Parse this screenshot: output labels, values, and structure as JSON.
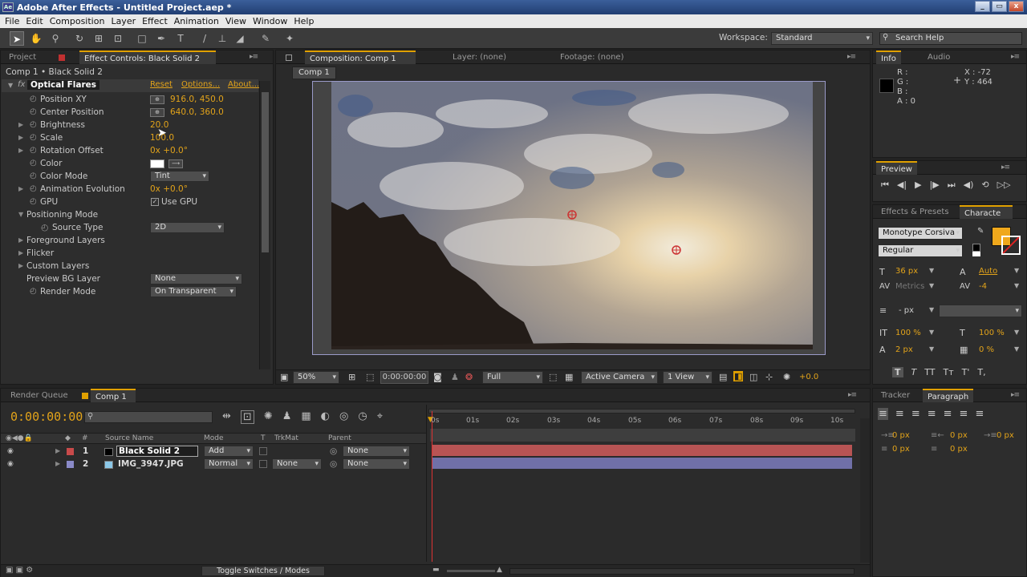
{
  "window": {
    "title": "Adobe After Effects - Untitled Project.aep *",
    "app_icon": "Ae",
    "buttons": {
      "minimize": "_",
      "maximize": "▭",
      "close": "x"
    }
  },
  "menu": [
    "File",
    "Edit",
    "Composition",
    "Layer",
    "Effect",
    "Animation",
    "View",
    "Window",
    "Help"
  ],
  "toolbar": {
    "workspace_label": "Workspace:",
    "workspace_value": "Standard",
    "search_placeholder": "Search Help"
  },
  "left_panel": {
    "tabs": {
      "project": "Project",
      "effect_controls": "Effect Controls: Black Solid 2"
    },
    "breadcrumb": "Comp 1 • Black Solid 2",
    "effect": {
      "name": "Optical Flares",
      "reset": "Reset",
      "options": "Options...",
      "about": "About...",
      "fx": "fx"
    },
    "props": [
      {
        "name": "Position XY",
        "value": "916.0, 450.0"
      },
      {
        "name": "Center Position",
        "value": "640.0, 360.0"
      },
      {
        "name": "Brightness",
        "value": "20.0"
      },
      {
        "name": "Scale",
        "value": "100.0"
      },
      {
        "name": "Rotation Offset",
        "value": "0x +0.0°"
      },
      {
        "name": "Color",
        "value": ""
      },
      {
        "name": "Color Mode",
        "value": "Tint"
      },
      {
        "name": "Animation Evolution",
        "value": "0x +0.0°"
      },
      {
        "name": "GPU",
        "value": "Use GPU"
      },
      {
        "name": "Positioning Mode",
        "value": ""
      },
      {
        "name": "Source Type",
        "value": "2D"
      },
      {
        "name": "Foreground Layers",
        "value": ""
      },
      {
        "name": "Flicker",
        "value": ""
      },
      {
        "name": "Custom Layers",
        "value": ""
      },
      {
        "name": "Preview BG Layer",
        "value": "None"
      },
      {
        "name": "Render Mode",
        "value": "On Transparent"
      }
    ]
  },
  "comp_panel": {
    "tabs": {
      "composition": "Composition: Comp 1",
      "layer": "Layer: (none)",
      "footage": "Footage: (none)"
    },
    "subtab": "Comp 1",
    "footer": {
      "zoom": "50%",
      "timecode": "0:00:00:00",
      "resolution": "Full",
      "camera": "Active Camera",
      "views": "1 View",
      "exposure": "+0.0"
    }
  },
  "info_panel": {
    "tabs": {
      "info": "Info",
      "audio": "Audio"
    },
    "r": "R :",
    "g": "G :",
    "b": "B :",
    "a": "A : 0",
    "x": "X : -72",
    "y": "Y : 464"
  },
  "preview_panel": {
    "title": "Preview"
  },
  "character_panel": {
    "tabs": {
      "effects": "Effects & Presets",
      "character": "Characte"
    },
    "font": "Monotype Corsiva",
    "style": "Regular",
    "size": "36 px",
    "leading": "Auto",
    "kerning": "Metrics",
    "tracking": "-4",
    "stroke": "- px",
    "vscale": "100 %",
    "hscale": "100 %",
    "baseline": "2 px",
    "tsume": "0 %",
    "fill_color": "#f0a81c"
  },
  "timeline": {
    "tabs": {
      "render_queue": "Render Queue",
      "comp": "Comp 1"
    },
    "timecode": "0:00:00:00",
    "headers": {
      "source": "Source Name",
      "mode": "Mode",
      "t": "T",
      "trkmat": "TrkMat",
      "parent": "Parent",
      "num": "#"
    },
    "ruler": [
      "0s",
      "01s",
      "02s",
      "03s",
      "04s",
      "05s",
      "06s",
      "07s",
      "08s",
      "09s",
      "10s"
    ],
    "layers": [
      {
        "num": "1",
        "name": "Black Solid 2",
        "mode": "Add",
        "trkmat": "",
        "parent": "None",
        "label_color": "#c84a4a",
        "bar_color": "#b85454"
      },
      {
        "num": "2",
        "name": "IMG_3947.JPG",
        "mode": "Normal",
        "trkmat": "None",
        "parent": "None",
        "label_color": "#8a8ac8",
        "bar_color": "#7070a8"
      }
    ],
    "footer": "Toggle Switches / Modes"
  },
  "paragraph_panel": {
    "tabs": {
      "tracker": "Tracker",
      "paragraph": "Paragraph"
    },
    "values": [
      "0 px",
      "0 px",
      "0 px",
      "0 px",
      "0 px"
    ]
  }
}
